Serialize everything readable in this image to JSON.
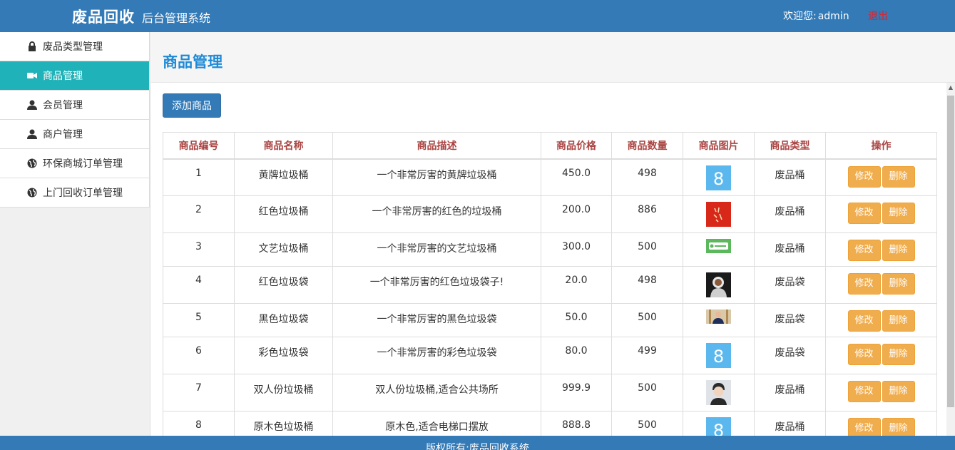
{
  "header": {
    "brand": "废品回收",
    "subtitle": "后台管理系统",
    "welcome_label": "欢迎您:",
    "username": "admin",
    "logout_label": "退出"
  },
  "sidebar": {
    "items": [
      {
        "label": "废品类型管理",
        "icon": "lock-icon"
      },
      {
        "label": "商品管理",
        "icon": "video-camera-icon",
        "active": true
      },
      {
        "label": "会员管理",
        "icon": "user-icon"
      },
      {
        "label": "商户管理",
        "icon": "user-icon"
      },
      {
        "label": "环保商城订单管理",
        "icon": "globe-icon"
      },
      {
        "label": "上门回收订单管理",
        "icon": "globe-icon"
      }
    ]
  },
  "main": {
    "title": "商品管理",
    "add_button": "添加商品",
    "columns": [
      "商品编号",
      "商品名称",
      "商品描述",
      "商品价格",
      "商品数量",
      "商品图片",
      "商品类型",
      "操作"
    ],
    "edit_label": "修改",
    "delete_label": "删除",
    "rows": [
      {
        "id": "1",
        "name": "黄牌垃圾桶",
        "desc": "一个非常厉害的黄牌垃圾桶",
        "price": "450.0",
        "qty": "498",
        "type": "废品桶"
      },
      {
        "id": "2",
        "name": "红色垃圾桶",
        "desc": "一个非常厉害的红色的垃圾桶",
        "price": "200.0",
        "qty": "886",
        "type": "废品桶"
      },
      {
        "id": "3",
        "name": "文艺垃圾桶",
        "desc": "一个非常厉害的文艺垃圾桶",
        "price": "300.0",
        "qty": "500",
        "type": "废品桶"
      },
      {
        "id": "4",
        "name": "红色垃圾袋",
        "desc": "一个非常厉害的红色垃圾袋子!",
        "price": "20.0",
        "qty": "498",
        "type": "废品袋"
      },
      {
        "id": "5",
        "name": "黑色垃圾袋",
        "desc": "一个非常厉害的黑色垃圾袋",
        "price": "50.0",
        "qty": "500",
        "type": "废品袋"
      },
      {
        "id": "6",
        "name": "彩色垃圾袋",
        "desc": "一个非常厉害的彩色垃圾袋",
        "price": "80.0",
        "qty": "499",
        "type": "废品袋"
      },
      {
        "id": "7",
        "name": "双人份垃圾桶",
        "desc": "双人份垃圾桶,适合公共场所",
        "price": "999.9",
        "qty": "500",
        "type": "废品桶"
      },
      {
        "id": "8",
        "name": "原木色垃圾桶",
        "desc": "原木色,适合电梯口摆放",
        "price": "888.8",
        "qty": "500",
        "type": "废品桶"
      }
    ]
  },
  "footer": {
    "text": "版权所有:废品回收系统"
  }
}
